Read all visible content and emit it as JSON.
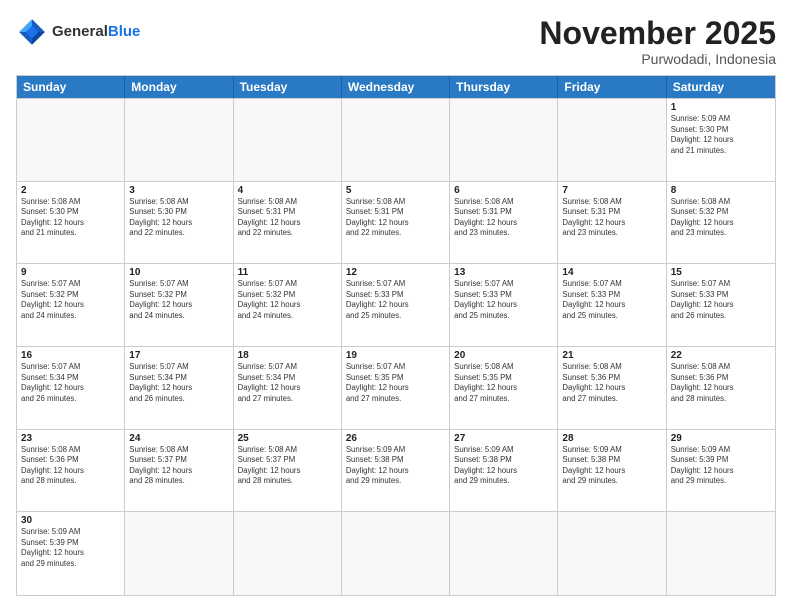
{
  "header": {
    "logo_general": "General",
    "logo_blue": "Blue",
    "month_title": "November 2025",
    "subtitle": "Purwodadi, Indonesia"
  },
  "day_headers": [
    "Sunday",
    "Monday",
    "Tuesday",
    "Wednesday",
    "Thursday",
    "Friday",
    "Saturday"
  ],
  "cells": [
    {
      "day": "",
      "info": "",
      "empty": true
    },
    {
      "day": "",
      "info": "",
      "empty": true
    },
    {
      "day": "",
      "info": "",
      "empty": true
    },
    {
      "day": "",
      "info": "",
      "empty": true
    },
    {
      "day": "",
      "info": "",
      "empty": true
    },
    {
      "day": "",
      "info": "",
      "empty": true
    },
    {
      "day": "1",
      "info": "Sunrise: 5:09 AM\nSunset: 5:30 PM\nDaylight: 12 hours\nand 21 minutes.",
      "empty": false
    },
    {
      "day": "2",
      "info": "Sunrise: 5:08 AM\nSunset: 5:30 PM\nDaylight: 12 hours\nand 21 minutes.",
      "empty": false
    },
    {
      "day": "3",
      "info": "Sunrise: 5:08 AM\nSunset: 5:30 PM\nDaylight: 12 hours\nand 22 minutes.",
      "empty": false
    },
    {
      "day": "4",
      "info": "Sunrise: 5:08 AM\nSunset: 5:31 PM\nDaylight: 12 hours\nand 22 minutes.",
      "empty": false
    },
    {
      "day": "5",
      "info": "Sunrise: 5:08 AM\nSunset: 5:31 PM\nDaylight: 12 hours\nand 22 minutes.",
      "empty": false
    },
    {
      "day": "6",
      "info": "Sunrise: 5:08 AM\nSunset: 5:31 PM\nDaylight: 12 hours\nand 23 minutes.",
      "empty": false
    },
    {
      "day": "7",
      "info": "Sunrise: 5:08 AM\nSunset: 5:31 PM\nDaylight: 12 hours\nand 23 minutes.",
      "empty": false
    },
    {
      "day": "8",
      "info": "Sunrise: 5:08 AM\nSunset: 5:32 PM\nDaylight: 12 hours\nand 23 minutes.",
      "empty": false
    },
    {
      "day": "9",
      "info": "Sunrise: 5:07 AM\nSunset: 5:32 PM\nDaylight: 12 hours\nand 24 minutes.",
      "empty": false
    },
    {
      "day": "10",
      "info": "Sunrise: 5:07 AM\nSunset: 5:32 PM\nDaylight: 12 hours\nand 24 minutes.",
      "empty": false
    },
    {
      "day": "11",
      "info": "Sunrise: 5:07 AM\nSunset: 5:32 PM\nDaylight: 12 hours\nand 24 minutes.",
      "empty": false
    },
    {
      "day": "12",
      "info": "Sunrise: 5:07 AM\nSunset: 5:33 PM\nDaylight: 12 hours\nand 25 minutes.",
      "empty": false
    },
    {
      "day": "13",
      "info": "Sunrise: 5:07 AM\nSunset: 5:33 PM\nDaylight: 12 hours\nand 25 minutes.",
      "empty": false
    },
    {
      "day": "14",
      "info": "Sunrise: 5:07 AM\nSunset: 5:33 PM\nDaylight: 12 hours\nand 25 minutes.",
      "empty": false
    },
    {
      "day": "15",
      "info": "Sunrise: 5:07 AM\nSunset: 5:33 PM\nDaylight: 12 hours\nand 26 minutes.",
      "empty": false
    },
    {
      "day": "16",
      "info": "Sunrise: 5:07 AM\nSunset: 5:34 PM\nDaylight: 12 hours\nand 26 minutes.",
      "empty": false
    },
    {
      "day": "17",
      "info": "Sunrise: 5:07 AM\nSunset: 5:34 PM\nDaylight: 12 hours\nand 26 minutes.",
      "empty": false
    },
    {
      "day": "18",
      "info": "Sunrise: 5:07 AM\nSunset: 5:34 PM\nDaylight: 12 hours\nand 27 minutes.",
      "empty": false
    },
    {
      "day": "19",
      "info": "Sunrise: 5:07 AM\nSunset: 5:35 PM\nDaylight: 12 hours\nand 27 minutes.",
      "empty": false
    },
    {
      "day": "20",
      "info": "Sunrise: 5:08 AM\nSunset: 5:35 PM\nDaylight: 12 hours\nand 27 minutes.",
      "empty": false
    },
    {
      "day": "21",
      "info": "Sunrise: 5:08 AM\nSunset: 5:36 PM\nDaylight: 12 hours\nand 27 minutes.",
      "empty": false
    },
    {
      "day": "22",
      "info": "Sunrise: 5:08 AM\nSunset: 5:36 PM\nDaylight: 12 hours\nand 28 minutes.",
      "empty": false
    },
    {
      "day": "23",
      "info": "Sunrise: 5:08 AM\nSunset: 5:36 PM\nDaylight: 12 hours\nand 28 minutes.",
      "empty": false
    },
    {
      "day": "24",
      "info": "Sunrise: 5:08 AM\nSunset: 5:37 PM\nDaylight: 12 hours\nand 28 minutes.",
      "empty": false
    },
    {
      "day": "25",
      "info": "Sunrise: 5:08 AM\nSunset: 5:37 PM\nDaylight: 12 hours\nand 28 minutes.",
      "empty": false
    },
    {
      "day": "26",
      "info": "Sunrise: 5:09 AM\nSunset: 5:38 PM\nDaylight: 12 hours\nand 29 minutes.",
      "empty": false
    },
    {
      "day": "27",
      "info": "Sunrise: 5:09 AM\nSunset: 5:38 PM\nDaylight: 12 hours\nand 29 minutes.",
      "empty": false
    },
    {
      "day": "28",
      "info": "Sunrise: 5:09 AM\nSunset: 5:38 PM\nDaylight: 12 hours\nand 29 minutes.",
      "empty": false
    },
    {
      "day": "29",
      "info": "Sunrise: 5:09 AM\nSunset: 5:39 PM\nDaylight: 12 hours\nand 29 minutes.",
      "empty": false
    },
    {
      "day": "30",
      "info": "Sunrise: 5:09 AM\nSunset: 5:39 PM\nDaylight: 12 hours\nand 29 minutes.",
      "empty": false
    },
    {
      "day": "",
      "info": "",
      "empty": true
    },
    {
      "day": "",
      "info": "",
      "empty": true
    },
    {
      "day": "",
      "info": "",
      "empty": true
    },
    {
      "day": "",
      "info": "",
      "empty": true
    },
    {
      "day": "",
      "info": "",
      "empty": true
    },
    {
      "day": "",
      "info": "",
      "empty": true
    }
  ]
}
